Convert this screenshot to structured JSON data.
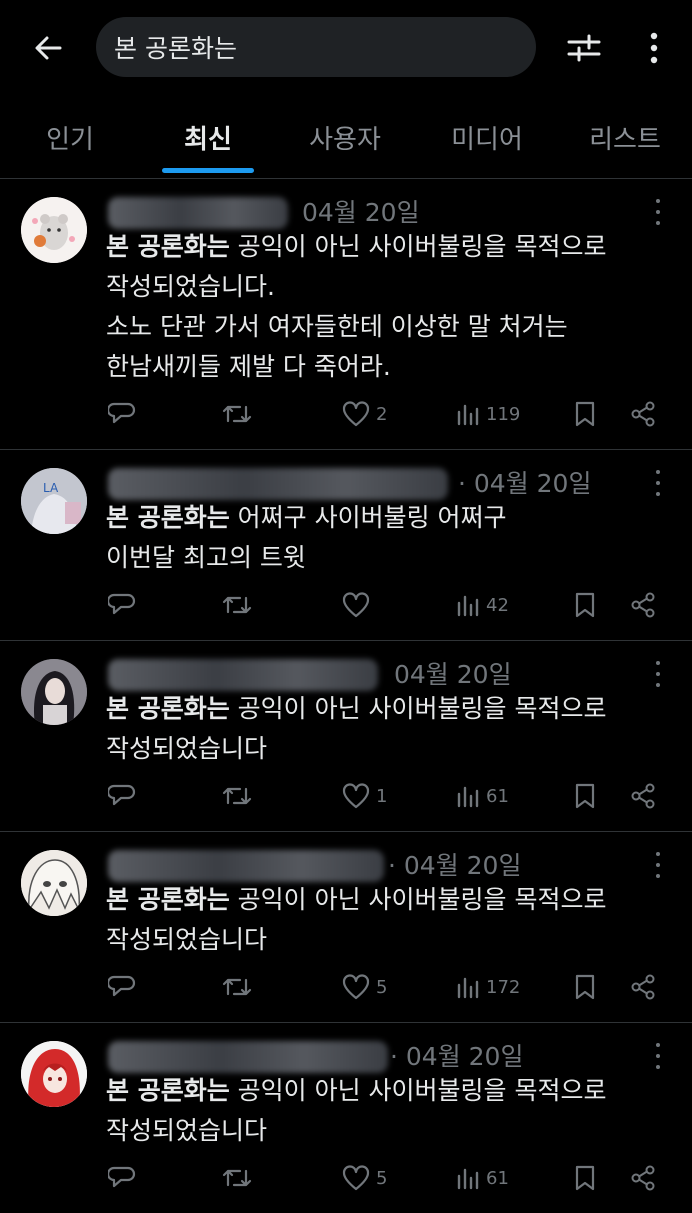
{
  "header": {
    "search_value": "본 공론화는"
  },
  "tabs": [
    {
      "label": "인기"
    },
    {
      "label": "최신"
    },
    {
      "label": "사용자"
    },
    {
      "label": "미디어"
    },
    {
      "label": "리스트"
    }
  ],
  "posts": [
    {
      "date": "04월 20일",
      "keyword": "본 공론화는",
      "line1_rest": " 공익이 아닌 사이버불링을 목적으로",
      "lines": [
        "작성되었습니다.",
        "소노 단관 가서 여자들한테 이상한 말 처거는",
        "한남새끼들 제발 다 죽어라."
      ],
      "likes": "2",
      "views": "119"
    },
    {
      "date": "· 04월 20일",
      "keyword": "본 공론화는",
      "line1_rest": " 어쩌구 사이버불링 어쩌구",
      "lines": [
        "이번달 최고의 트윗"
      ],
      "likes": "",
      "views": "42"
    },
    {
      "date": "04월 20일",
      "keyword": "본 공론화는",
      "line1_rest": " 공익이 아닌 사이버불링을 목적으로",
      "lines": [
        "작성되었습니다"
      ],
      "likes": "1",
      "views": "61"
    },
    {
      "date": "· 04월 20일",
      "keyword": "본 공론화는",
      "line1_rest": " 공익이 아닌 사이버불링을 목적으로",
      "lines": [
        "작성되었습니다"
      ],
      "likes": "5",
      "views": "172"
    },
    {
      "date": "· 04월 20일",
      "keyword": "본 공론화는",
      "line1_rest": " 공익이 아닌 사이버불링을 목적으로",
      "lines": [
        "작성되었습니다"
      ],
      "likes": "5",
      "views": "61"
    }
  ],
  "icons": {
    "back": "arrow-left-icon",
    "filter": "sliders-icon",
    "more": "more-vertical-icon",
    "reply": "reply-icon",
    "repost": "repost-icon",
    "like": "heart-icon",
    "views": "views-icon",
    "bookmark": "bookmark-icon",
    "share": "share-icon"
  },
  "colors": {
    "background": "#000000",
    "text": "#e7e9ea",
    "muted": "#71767b",
    "accent": "#1d9bf0",
    "search_bg": "#1f2225"
  }
}
